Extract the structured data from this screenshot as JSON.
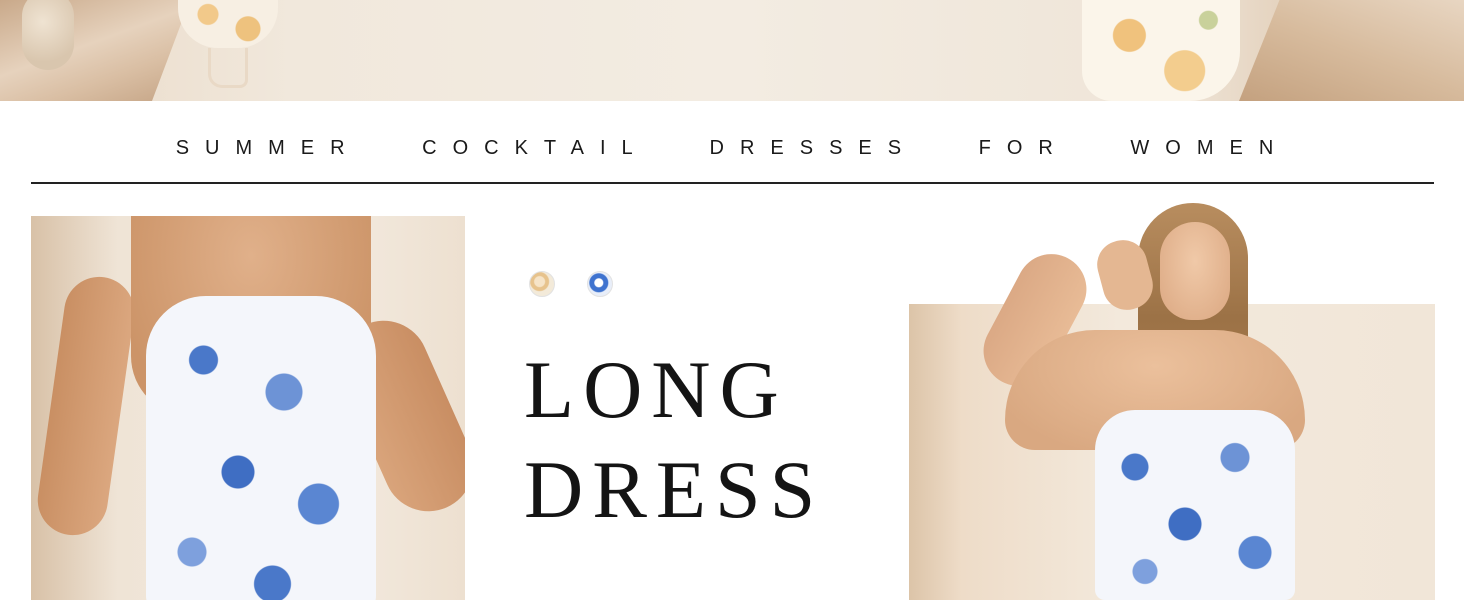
{
  "banner": {
    "heading": "SUMMER COCKTAIL DRESSES FOR WOMEN"
  },
  "product": {
    "title_line_1": "LONG",
    "title_line_2": "DRESS",
    "color_swatches": [
      {
        "name": "beige-floral-swatch",
        "color": "#e7c38d"
      },
      {
        "name": "blue-floral-swatch",
        "color": "#3f73cf"
      }
    ]
  },
  "colors": {
    "text": "#141414",
    "rule": "#222222",
    "print_blue": "#4a78c9"
  }
}
